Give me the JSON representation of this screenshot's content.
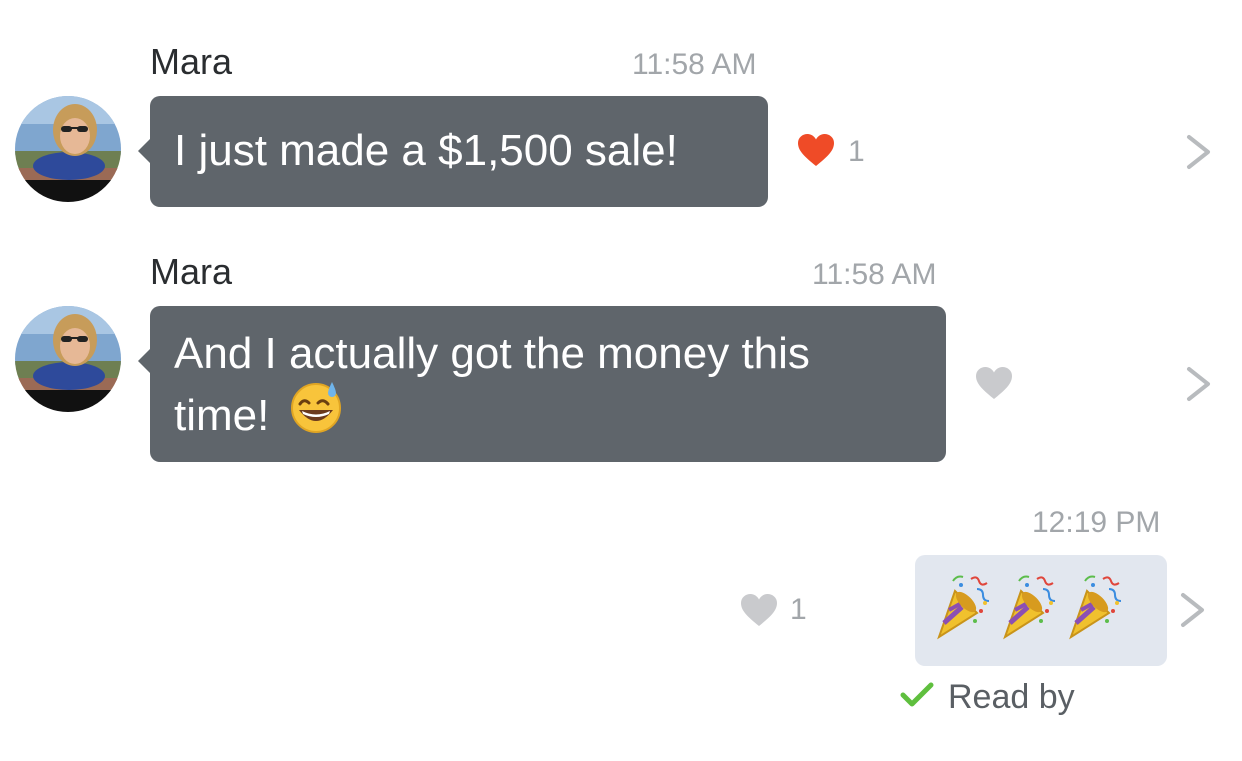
{
  "messages": [
    {
      "sender": "Mara",
      "time": "11:58 AM",
      "text": "I just made a $1,500 sale!",
      "likes": "1",
      "liked": true
    },
    {
      "sender": "Mara",
      "time": "11:58 AM",
      "text_line1": "And I actually got the money this",
      "text_line2": "time!",
      "emoji": "grinning-face-with-sweat",
      "liked": false
    }
  ],
  "outgoing": {
    "time": "12:19 PM",
    "emoji": "party-popper-x3",
    "likes": "1",
    "read_status": "Read by"
  },
  "colors": {
    "incoming_bubble": "#5f656b",
    "outgoing_bubble": "#e2e7ef",
    "heart_active": "#ef4b27",
    "heart_inactive": "#c9cacd",
    "check": "#5fbf3e"
  }
}
